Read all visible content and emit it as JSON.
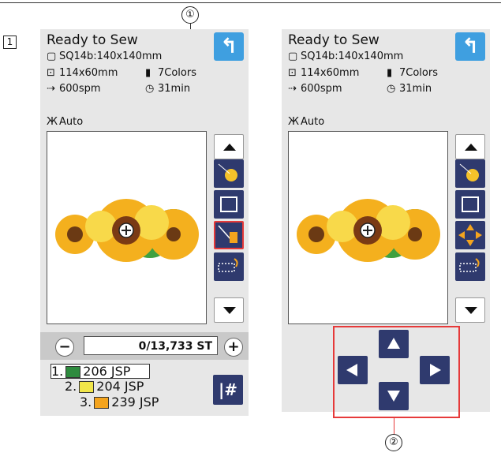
{
  "step_label": "1",
  "callouts": {
    "one": "①",
    "two": "②"
  },
  "screen": {
    "title": "Ready to Sew",
    "hoop": "SQ14b:140x140mm",
    "size": "114x60mm",
    "colors": "7Colors",
    "speed": "600spm",
    "time": "31min",
    "tension": "Auto"
  },
  "stitch_counter": "0/13,733 ST",
  "minus_label": "−",
  "plus_label": "+",
  "hash_label": "|#",
  "color_list": [
    {
      "index": "1.",
      "code": "206 JSP",
      "color": "#2e8b3e"
    },
    {
      "index": "2.",
      "code": "204 JSP",
      "color": "#f1e64a"
    },
    {
      "index": "3.",
      "code": "239 JSP",
      "color": "#f4a41e"
    }
  ],
  "colors": {
    "accent_blue": "#3f9fe0",
    "button_navy": "#2f3a6e",
    "highlight_red": "#e63a3a"
  }
}
